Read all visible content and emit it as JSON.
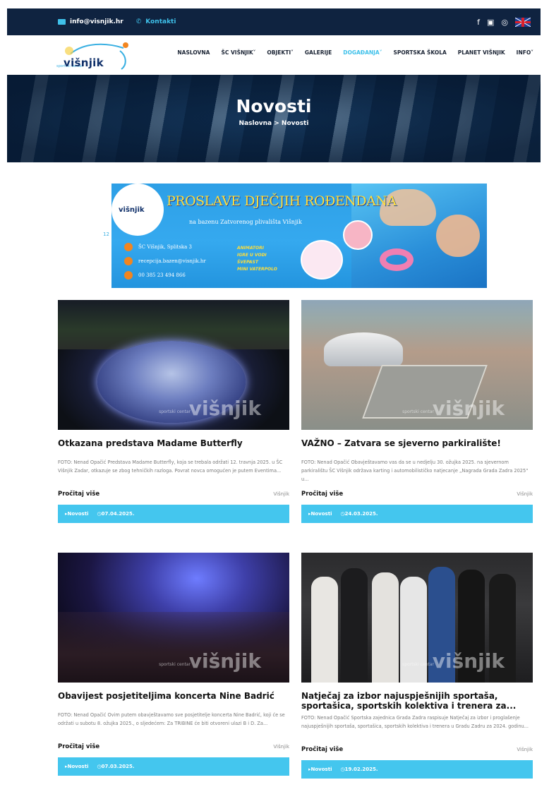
{
  "topbar": {
    "email": "info@visnjik.hr",
    "contact": "Kontakti",
    "social_icons": [
      "facebook-icon",
      "youtube-icon",
      "instagram-icon"
    ],
    "language_flag": "uk-flag-icon"
  },
  "nav": {
    "logo_text": "višnjik",
    "logo_small": "sportski centar",
    "items": [
      {
        "label": "NASLOVNA"
      },
      {
        "label": "ŠC VIŠNJIK"
      },
      {
        "label": "OBJEKTI"
      },
      {
        "label": "GALERIJE"
      },
      {
        "label": "DOGAĐANJA"
      },
      {
        "label": "SPORTSKA ŠKOLA"
      },
      {
        "label": "PLANET VIŠNJIK"
      },
      {
        "label": "INFO"
      }
    ],
    "active_color": "#3fc1ea"
  },
  "hero": {
    "title": "Novosti",
    "breadcrumb": "Naslovna > Novosti"
  },
  "banner": {
    "number": "12",
    "logo_text": "višnjik",
    "headline": "PROSLAVE DJEČJIH ROĐENDANA",
    "subheadline": "na bazenu Zatvorenog plivališta Višnjik",
    "address": "ŠC Višnjik, Splitska 3",
    "email": "recepcija.bazen@visnjik.hr",
    "phone": "00 385 23 494 866",
    "tags": [
      "ANIMATORI",
      "IGRE U VODI",
      "ŠVEPAST",
      "MINI VATERPOLO"
    ]
  },
  "cards": [
    {
      "title": "Otkazana predstava Madame Butterfly",
      "excerpt": "FOTO: Nenad Opačić Predstava Madame Butterfly, koja se trebala održati 12. travnja 2025. u ŠC Višnjik Zadar, otkazuje se zbog tehničkih razloga. Povrat novca omogućen je putem Eventima...",
      "read_more": "Pročitaj više",
      "author": "Višnjik",
      "category": "Novosti",
      "date": "07.04.2025."
    },
    {
      "title": "VAŽNO – Zatvara se sjeverno parkiralište!",
      "excerpt": "FOTO: Nenad Opačić Obavještavamo vas da se u nedjelju 30. ožujka 2025. na sjevernom parkiralištu ŠC Višnjik održava karting i automobilističko natjecanje „Nagrada Grada Zadra 2025“ u...",
      "read_more": "Pročitaj više",
      "author": "Višnjik",
      "category": "Novosti",
      "date": "24.03.2025."
    },
    {
      "title": "Obavijest posjetiteljima koncerta Nine Badrić",
      "excerpt": "FOTO: Nenad Opačić Ovim putem obavještavamo sve posjetitelje koncerta Nine Badrić, koji će se održati u subotu 8. ožujka 2025., o sljedećem: Za TRIBINE će biti otvoreni ulazi B i D. Za...",
      "read_more": "Pročitaj više",
      "author": "Višnjik",
      "category": "Novosti",
      "date": "07.03.2025."
    },
    {
      "title": "Natječaj za izbor najuspješnijih sportaša, sportašica, sportskih kolektiva i trenera za...",
      "excerpt": "FOTO: Nenad Opačić Sportska zajednica Grada Zadra raspisuje Natječaj za izbor i proglašenje najuspješnijih sportaša, sportašica, sportskih kolektiva i trenera u Gradu Zadru za 2024. godinu...",
      "read_more": "Pročitaj više",
      "author": "Višnjik",
      "category": "Novosti",
      "date": "19.02.2025."
    }
  ],
  "watermark": {
    "text": "višnjik",
    "small": "sportski centar"
  }
}
